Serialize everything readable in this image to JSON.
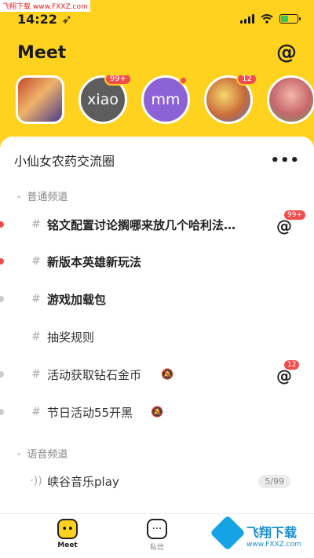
{
  "watermark_top": "飞翔下载 www.FXXZ.com",
  "status": {
    "time": "14:22 ➶"
  },
  "header": {
    "title": "Meet",
    "at_icon": "@"
  },
  "avatars": [
    {
      "label": "",
      "badge": ""
    },
    {
      "label": "xiao",
      "badge": "99+"
    },
    {
      "label": "mm",
      "badge": ""
    },
    {
      "label": "",
      "badge": "12"
    },
    {
      "label": "",
      "badge": ""
    }
  ],
  "group": {
    "name": "小仙女农药交流圈",
    "more": "•••"
  },
  "sections": {
    "text": "普通频道",
    "voice": "语音频道"
  },
  "channels": [
    {
      "icon": "#",
      "name": "铭文配置讨论搁哪来放几个哈利法…",
      "at_badge": "99+",
      "dot_color": "#f24d4d"
    },
    {
      "icon": "#",
      "name": "新版本英雄新玩法",
      "dot_color": "#f24d4d"
    },
    {
      "icon": "#",
      "name": "游戏加载包",
      "dot_color": "#cccccc"
    },
    {
      "icon": "#",
      "name": "抽奖规则"
    },
    {
      "icon": "#",
      "name": "活动获取钻石金币",
      "at_badge": "12",
      "dot_color": "#cccccc"
    },
    {
      "icon": "#",
      "name": "节日活动55开黑",
      "dot_color": "#cccccc"
    }
  ],
  "voice_channels": [
    {
      "icon": "·))",
      "name": "峡谷音乐play",
      "count": "5/99"
    }
  ],
  "tabbar": {
    "meet": "Meet",
    "messages": "私信"
  },
  "brand_watermark": {
    "title": "飞翔下载",
    "url": "www.FXXZ.com"
  },
  "colors": {
    "brand": "#FFD21F",
    "badge": "#f24d4d"
  }
}
